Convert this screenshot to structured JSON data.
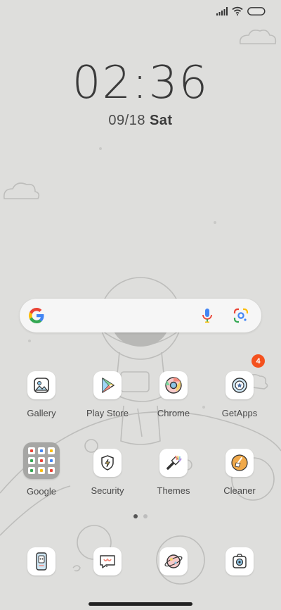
{
  "clock": {
    "time": "02:36",
    "date": "09/18",
    "day": "Sat"
  },
  "status_bar": {
    "icons": [
      "signal-icon",
      "wifi-icon",
      "battery-icon"
    ]
  },
  "search_bar": {
    "icons": [
      "google-g-icon",
      "microphone-icon",
      "google-lens-icon"
    ]
  },
  "apps": {
    "row1": [
      {
        "label": "Gallery",
        "icon": "gallery-icon"
      },
      {
        "label": "Play Store",
        "icon": "play-store-icon"
      },
      {
        "label": "Chrome",
        "icon": "chrome-icon"
      },
      {
        "label": "GetApps",
        "icon": "getapps-icon",
        "badge": "4"
      }
    ],
    "row2": [
      {
        "label": "Google",
        "icon": "google-folder-icon"
      },
      {
        "label": "Security",
        "icon": "security-icon"
      },
      {
        "label": "Themes",
        "icon": "themes-icon"
      },
      {
        "label": "Cleaner",
        "icon": "cleaner-icon"
      }
    ]
  },
  "dock": [
    {
      "icon": "phone-icon"
    },
    {
      "icon": "messaging-icon"
    },
    {
      "icon": "browser-icon"
    },
    {
      "icon": "camera-icon"
    }
  ],
  "page_indicator": {
    "pages": 2,
    "current": 1
  },
  "colors": {
    "background": "#dededc",
    "badge": "#f4511e",
    "google_blue": "#4285f4",
    "google_red": "#ea4335",
    "google_yellow": "#fbbc05",
    "google_green": "#34a853"
  }
}
